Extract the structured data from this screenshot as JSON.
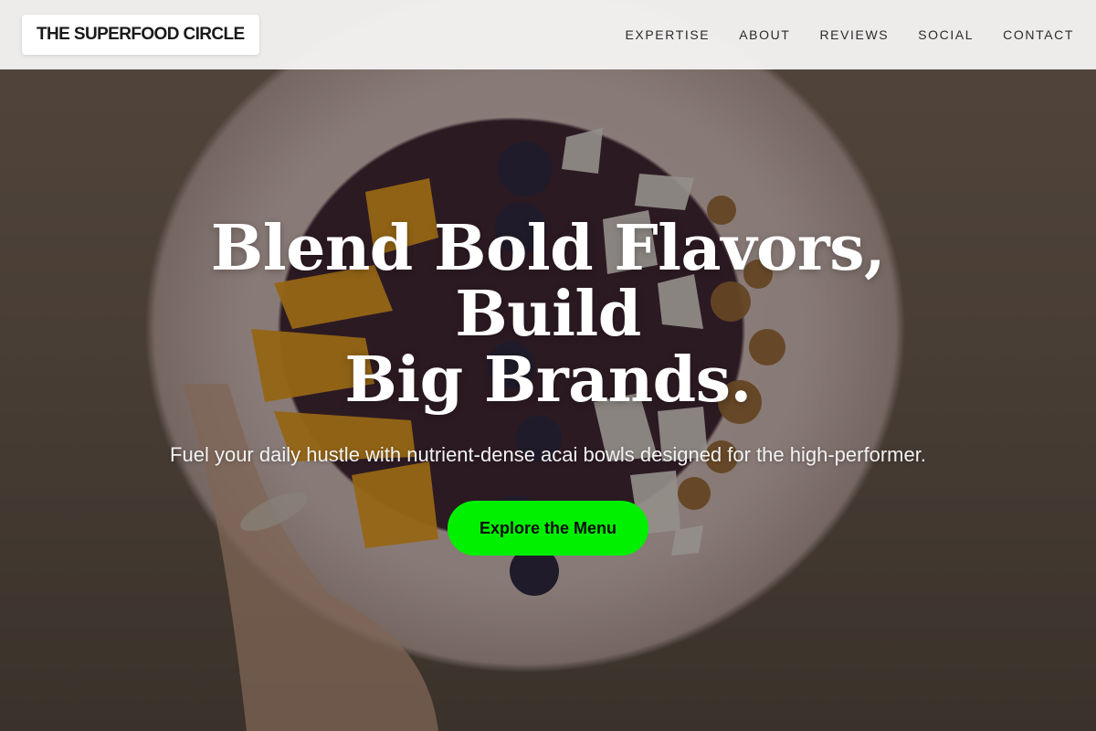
{
  "header": {
    "brand": "THE SUPERFOOD CIRCLE",
    "nav": [
      {
        "label": "EXPERTISE"
      },
      {
        "label": "ABOUT"
      },
      {
        "label": "REVIEWS"
      },
      {
        "label": "SOCIAL"
      },
      {
        "label": "CONTACT"
      }
    ]
  },
  "hero": {
    "title_line1": "Blend Bold Flavors, Build",
    "title_line2": "Big Brands.",
    "subtitle": "Fuel your daily hustle with nutrient-dense acai bowls designed for the high-performer.",
    "cta_label": "Explore the Menu"
  },
  "colors": {
    "accent": "#00f000",
    "nav_background": "#f5f3f2",
    "hero_text": "#ffffff"
  }
}
